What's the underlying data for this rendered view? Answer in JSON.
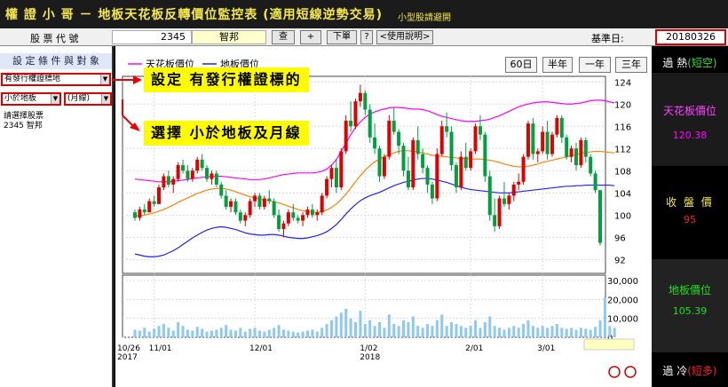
{
  "titlebar": {
    "title": "權 證 小 哥 －  地板天花板反轉價位監控表 (適用短線逆勢交易)",
    "subtitle": "小型股請避開"
  },
  "toolbar": {
    "stock_code_label": "股 票 代 號",
    "stock_code": "2345",
    "stock_name": "智邦",
    "query_btn": "查",
    "plus_btn": "+",
    "next_btn": "下單",
    "help_q_btn": "?",
    "manual_btn": "<使用說明>",
    "base_date_label": "基準日:",
    "base_date": "20180326"
  },
  "left_panel": {
    "header": "設 定 條 件 與 對 象",
    "select_warrant": "有發行權證標地",
    "select_condition": "小於地板",
    "select_line": "(月線)",
    "list_label": "請選擇股票",
    "list_item": "2345 智邦"
  },
  "callouts": {
    "c1": "設定 有發行權證標的",
    "c2": "選擇 小於地板及月線"
  },
  "chart_buttons": [
    "60日",
    "半年",
    "一年",
    "三年"
  ],
  "legend": {
    "ceiling": "天花板價位",
    "floor": "地板價位"
  },
  "right_panel": {
    "overheat": "過 熱",
    "overheat_tag": "(短空)",
    "ceiling_label": "天花板價位",
    "ceiling_value": "120.38",
    "close_label": "收 盤 價",
    "close_value": "95",
    "floor_label": "地板價位",
    "floor_value": "105.39",
    "overcold": "過 冷",
    "overcold_tag": "(短多)"
  },
  "colors": {
    "up": "#e00000",
    "down": "#00a040",
    "ceiling": "#ff00ff",
    "floor": "#2020ff",
    "ma": "#ff8000",
    "vol": "#8fc8f0",
    "callout_bg": "#fffb00",
    "title_fg": "#f4e84a"
  },
  "chart_data": {
    "type": "candlestick",
    "y_ticks": [
      "124",
      "120",
      "116",
      "112",
      "108",
      "104",
      "100",
      "96",
      "92"
    ],
    "vol_ticks": [
      "30,000",
      "20,000",
      "10,000",
      "0"
    ],
    "x_labels": [
      "10/26",
      "11/01",
      "12/01",
      "1/02",
      "2/01",
      "3/01"
    ],
    "year_labels": [
      "2017",
      "2018"
    ],
    "ylim": [
      89.5,
      125
    ],
    "vol_ylim": [
      0,
      30000
    ],
    "candles": [
      [
        100.5,
        101.0,
        99.0,
        99.5
      ],
      [
        99.5,
        101.5,
        99.0,
        101.0
      ],
      [
        101.0,
        102.0,
        100.0,
        100.5
      ],
      [
        100.5,
        103.0,
        100.5,
        102.5
      ],
      [
        102.5,
        103.5,
        101.5,
        102.0
      ],
      [
        102.0,
        105.5,
        102.0,
        105.0
      ],
      [
        105.0,
        107.5,
        104.5,
        107.0
      ],
      [
        107.0,
        108.0,
        105.0,
        105.5
      ],
      [
        105.5,
        107.0,
        104.0,
        106.5
      ],
      [
        106.5,
        109.5,
        106.0,
        109.0
      ],
      [
        109.0,
        110.0,
        107.5,
        108.0
      ],
      [
        108.0,
        109.0,
        106.0,
        106.5
      ],
      [
        106.5,
        108.5,
        106.0,
        108.0
      ],
      [
        108.0,
        110.5,
        107.5,
        110.0
      ],
      [
        110.0,
        111.0,
        108.0,
        108.5
      ],
      [
        108.5,
        109.0,
        106.0,
        106.5
      ],
      [
        106.5,
        108.0,
        105.5,
        107.5
      ],
      [
        107.5,
        108.0,
        105.0,
        105.5
      ],
      [
        105.5,
        106.0,
        103.0,
        103.5
      ],
      [
        103.5,
        104.5,
        101.0,
        101.5
      ],
      [
        101.5,
        103.0,
        100.5,
        102.5
      ],
      [
        102.5,
        103.0,
        100.0,
        100.5
      ],
      [
        100.5,
        101.0,
        98.5,
        99.0
      ],
      [
        99.0,
        100.5,
        98.0,
        100.0
      ],
      [
        100.0,
        103.0,
        99.5,
        102.5
      ],
      [
        102.5,
        104.0,
        101.5,
        103.5
      ],
      [
        103.5,
        104.0,
        101.0,
        101.5
      ],
      [
        101.5,
        103.5,
        101.0,
        103.0
      ],
      [
        103.0,
        104.5,
        102.0,
        102.5
      ],
      [
        102.5,
        103.0,
        99.5,
        100.0
      ],
      [
        100.0,
        101.0,
        97.0,
        97.5
      ],
      [
        97.5,
        99.0,
        96.0,
        98.5
      ],
      [
        98.5,
        101.0,
        98.0,
        100.5
      ],
      [
        100.5,
        102.0,
        99.0,
        99.5
      ],
      [
        99.5,
        100.0,
        98.5,
        99.0
      ],
      [
        99.0,
        100.5,
        98.0,
        100.0
      ],
      [
        100.0,
        101.5,
        99.5,
        101.0
      ],
      [
        101.0,
        102.0,
        99.5,
        100.0
      ],
      [
        100.0,
        101.0,
        99.0,
        100.5
      ],
      [
        100.5,
        104.0,
        100.0,
        103.5
      ],
      [
        103.5,
        107.0,
        103.0,
        106.5
      ],
      [
        106.5,
        109.0,
        105.0,
        108.5
      ],
      [
        108.5,
        110.0,
        104.0,
        105.0
      ],
      [
        105.0,
        112.0,
        104.5,
        111.5
      ],
      [
        111.5,
        118.0,
        111.0,
        117.0
      ],
      [
        117.0,
        120.5,
        115.0,
        116.0
      ],
      [
        116.0,
        121.0,
        115.5,
        120.5
      ],
      [
        120.5,
        123.5,
        119.5,
        122.0
      ],
      [
        122.0,
        122.5,
        118.0,
        119.0
      ],
      [
        119.0,
        120.0,
        113.0,
        114.0
      ],
      [
        114.0,
        116.5,
        111.0,
        112.0
      ],
      [
        112.0,
        112.5,
        106.0,
        107.0
      ],
      [
        107.0,
        111.0,
        106.5,
        110.5
      ],
      [
        110.5,
        118.0,
        110.0,
        117.0
      ],
      [
        117.0,
        119.5,
        114.5,
        115.0
      ],
      [
        115.0,
        115.5,
        111.0,
        112.5
      ],
      [
        112.5,
        113.0,
        107.0,
        108.0
      ],
      [
        108.0,
        110.5,
        104.5,
        105.0
      ],
      [
        105.0,
        114.0,
        104.5,
        113.5
      ],
      [
        113.5,
        116.0,
        110.0,
        111.0
      ],
      [
        111.0,
        112.0,
        107.5,
        108.5
      ],
      [
        108.5,
        109.0,
        104.0,
        105.5
      ],
      [
        105.5,
        106.0,
        102.0,
        103.0
      ],
      [
        103.0,
        112.0,
        102.5,
        111.0
      ],
      [
        111.0,
        117.0,
        110.5,
        116.0
      ],
      [
        116.0,
        118.5,
        114.0,
        115.0
      ],
      [
        115.0,
        116.0,
        108.0,
        109.0
      ],
      [
        109.0,
        109.5,
        104.0,
        105.0
      ],
      [
        105.0,
        111.5,
        104.5,
        110.5
      ],
      [
        110.5,
        113.0,
        108.0,
        108.5
      ],
      [
        108.5,
        112.0,
        108.0,
        111.5
      ],
      [
        111.5,
        116.5,
        111.0,
        116.0
      ],
      [
        116.0,
        118.0,
        113.5,
        114.5
      ],
      [
        114.5,
        115.0,
        106.0,
        107.0
      ],
      [
        107.0,
        108.0,
        99.0,
        100.0
      ],
      [
        100.0,
        103.0,
        97.0,
        98.0
      ],
      [
        98.0,
        103.5,
        97.5,
        103.0
      ],
      [
        103.0,
        106.0,
        101.5,
        102.0
      ],
      [
        102.0,
        104.0,
        101.0,
        103.5
      ],
      [
        103.5,
        106.0,
        102.5,
        105.5
      ],
      [
        105.5,
        107.5,
        104.5,
        106.0
      ],
      [
        106.0,
        111.0,
        105.5,
        110.5
      ],
      [
        110.5,
        117.0,
        110.0,
        116.5
      ],
      [
        116.5,
        117.5,
        110.0,
        111.0
      ],
      [
        111.0,
        112.0,
        109.5,
        111.5
      ],
      [
        111.5,
        116.0,
        111.0,
        115.0
      ],
      [
        115.0,
        117.0,
        110.0,
        111.0
      ],
      [
        111.0,
        115.0,
        110.5,
        114.5
      ],
      [
        114.5,
        118.0,
        114.0,
        117.5
      ],
      [
        117.5,
        118.0,
        113.0,
        114.0
      ],
      [
        114.0,
        114.5,
        110.0,
        110.5
      ],
      [
        110.5,
        112.5,
        109.5,
        112.0
      ],
      [
        112.0,
        113.0,
        108.0,
        109.0
      ],
      [
        109.0,
        114.0,
        108.5,
        113.5
      ],
      [
        113.5,
        114.0,
        109.5,
        110.5
      ],
      [
        110.5,
        111.0,
        107.0,
        107.5
      ],
      [
        107.5,
        108.0,
        104.0,
        104.5
      ],
      [
        104.5,
        104.5,
        94.5,
        95.0
      ]
    ],
    "ceiling_line": [
      106.5,
      106.4,
      106.3,
      106.2,
      106.1,
      106.0,
      106.0,
      106.0,
      106.1,
      106.2,
      106.3,
      106.4,
      106.6,
      106.7,
      106.8,
      106.9,
      107.0,
      107.0,
      107.0,
      106.9,
      106.8,
      106.7,
      106.6,
      106.5,
      106.4,
      106.4,
      106.4,
      106.5,
      106.7,
      106.9,
      107.1,
      107.3,
      107.4,
      107.5,
      107.6,
      107.6,
      107.6,
      107.6,
      107.7,
      107.9,
      108.3,
      109.0,
      110.0,
      111.5,
      113.0,
      114.5,
      115.8,
      116.8,
      117.6,
      118.2,
      118.6,
      118.9,
      119.1,
      119.3,
      119.4,
      119.4,
      119.3,
      119.2,
      119.1,
      119.1,
      119.0,
      118.8,
      118.5,
      118.1,
      117.8,
      117.6,
      117.4,
      117.2,
      117.0,
      116.9,
      116.9,
      116.9,
      117.0,
      117.1,
      117.3,
      117.6,
      117.9,
      118.3,
      118.7,
      119.1,
      119.5,
      119.8,
      120.0,
      120.2,
      120.3,
      120.4,
      120.4,
      120.3,
      120.2,
      120.1,
      120.0,
      120.0,
      120.1,
      120.2,
      120.4,
      120.6,
      120.7,
      120.7,
      120.6,
      120.4,
      120.2
    ],
    "floor_line": [
      93.0,
      92.8,
      92.6,
      92.5,
      92.5,
      92.6,
      92.8,
      93.2,
      93.6,
      94.1,
      94.7,
      95.3,
      95.9,
      96.4,
      96.9,
      97.3,
      97.6,
      97.8,
      97.9,
      97.8,
      97.6,
      97.4,
      97.1,
      96.8,
      96.6,
      96.5,
      96.4,
      96.4,
      96.5,
      96.5,
      96.4,
      96.2,
      96.0,
      95.9,
      95.8,
      95.8,
      95.9,
      96.1,
      96.3,
      96.6,
      97.0,
      97.6,
      98.3,
      99.2,
      100.2,
      101.1,
      101.9,
      102.6,
      103.1,
      103.5,
      103.8,
      104.1,
      104.5,
      104.9,
      105.3,
      105.6,
      105.9,
      106.1,
      106.3,
      106.5,
      106.6,
      106.6,
      106.5,
      106.3,
      106.1,
      105.9,
      105.6,
      105.3,
      105.0,
      104.8,
      104.6,
      104.5,
      104.4,
      104.3,
      104.2,
      104.1,
      104.0,
      104.0,
      104.0,
      104.1,
      104.2,
      104.3,
      104.4,
      104.5,
      104.6,
      104.7,
      104.8,
      104.9,
      105.0,
      105.1,
      105.2,
      105.2,
      105.3,
      105.3,
      105.4,
      105.4,
      105.4,
      105.4,
      105.4,
      105.4,
      105.3
    ],
    "ma_line": [
      99.8,
      99.9,
      100.0,
      100.2,
      100.4,
      100.7,
      101.0,
      101.4,
      101.8,
      102.3,
      102.7,
      103.1,
      103.5,
      103.9,
      104.2,
      104.5,
      104.7,
      104.8,
      104.8,
      104.7,
      104.5,
      104.2,
      103.9,
      103.6,
      103.3,
      103.1,
      102.9,
      102.7,
      102.6,
      102.4,
      102.2,
      101.9,
      101.6,
      101.3,
      101.0,
      100.8,
      100.6,
      100.5,
      100.5,
      100.6,
      100.9,
      101.4,
      102.0,
      102.8,
      103.8,
      104.9,
      106.0,
      107.1,
      108.1,
      108.9,
      109.6,
      110.1,
      110.5,
      110.9,
      111.2,
      111.5,
      111.6,
      111.6,
      111.5,
      111.4,
      111.2,
      111.0,
      110.8,
      110.7,
      110.6,
      110.5,
      110.4,
      110.3,
      110.2,
      110.2,
      110.1,
      110.1,
      110.1,
      110.0,
      109.9,
      109.7,
      109.5,
      109.2,
      109.0,
      108.8,
      108.7,
      108.7,
      108.8,
      109.0,
      109.2,
      109.5,
      109.7,
      109.9,
      110.1,
      110.3,
      110.5,
      110.7,
      110.9,
      111.1,
      111.3,
      111.4,
      111.5,
      111.5,
      111.4,
      111.3,
      111.2
    ],
    "volume": [
      4000,
      3500,
      5000,
      3000,
      4500,
      6000,
      7000,
      5000,
      3500,
      8000,
      6000,
      4000,
      3500,
      5500,
      4500,
      3000,
      3500,
      4000,
      5000,
      6500,
      4000,
      3500,
      5000,
      3000,
      4500,
      5000,
      3500,
      3000,
      4000,
      5000,
      6500,
      4000,
      3500,
      3000,
      2500,
      3000,
      3500,
      4000,
      3000,
      5000,
      7000,
      9000,
      11000,
      13000,
      15000,
      10000,
      8000,
      14000,
      7000,
      9000,
      6000,
      8000,
      5000,
      12000,
      7000,
      6000,
      9000,
      8000,
      11000,
      6000,
      5000,
      7000,
      6000,
      9000,
      12000,
      6000,
      8000,
      7000,
      6000,
      5000,
      6000,
      9000,
      5000,
      8000,
      11000,
      6000,
      5000,
      4000,
      5000,
      6000,
      5000,
      7000,
      9000,
      6000,
      5000,
      6000,
      5000,
      6000,
      7000,
      5000,
      4500,
      5000,
      4000,
      5000,
      4500,
      4000,
      5500,
      9000,
      21000,
      6000,
      5000
    ],
    "spikes": [
      [
        23,
        21000
      ],
      [
        43,
        17000
      ]
    ]
  }
}
